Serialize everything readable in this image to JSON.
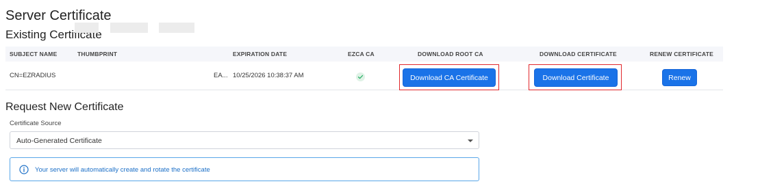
{
  "page": {
    "title": "Server Certificate",
    "existing_title": "Existing Certificate"
  },
  "table": {
    "headers": {
      "subject": "SUBJECT NAME",
      "thumbprint": "THUMBPRINT",
      "expiration": "EXPIRATION DATE",
      "ezca": "EZCA CA",
      "download_root": "DOWNLOAD ROOT CA",
      "download_cert": "DOWNLOAD CERTIFICATE",
      "renew": "RENEW CERTIFICATE"
    },
    "row": {
      "subject": "CN=EZRADIUS",
      "thumbprint_suffix": "EA...",
      "expiration": "10/25/2026 10:38:37 AM",
      "ezca_icon": "check-circle-icon",
      "download_ca_label": "Download CA Certificate",
      "download_cert_label": "Download Certificate",
      "renew_label": "Renew"
    }
  },
  "request": {
    "title": "Request New Certificate",
    "source_label": "Certificate Source",
    "source_value": "Auto-Generated Certificate",
    "info_message": "Your server will automatically create and rotate the certificate",
    "info_icon": "info-circle-icon"
  },
  "colors": {
    "primary": "#1a73e8",
    "highlight": "#e0262b",
    "success": "#2fb26b",
    "info": "#1b6fc7"
  }
}
